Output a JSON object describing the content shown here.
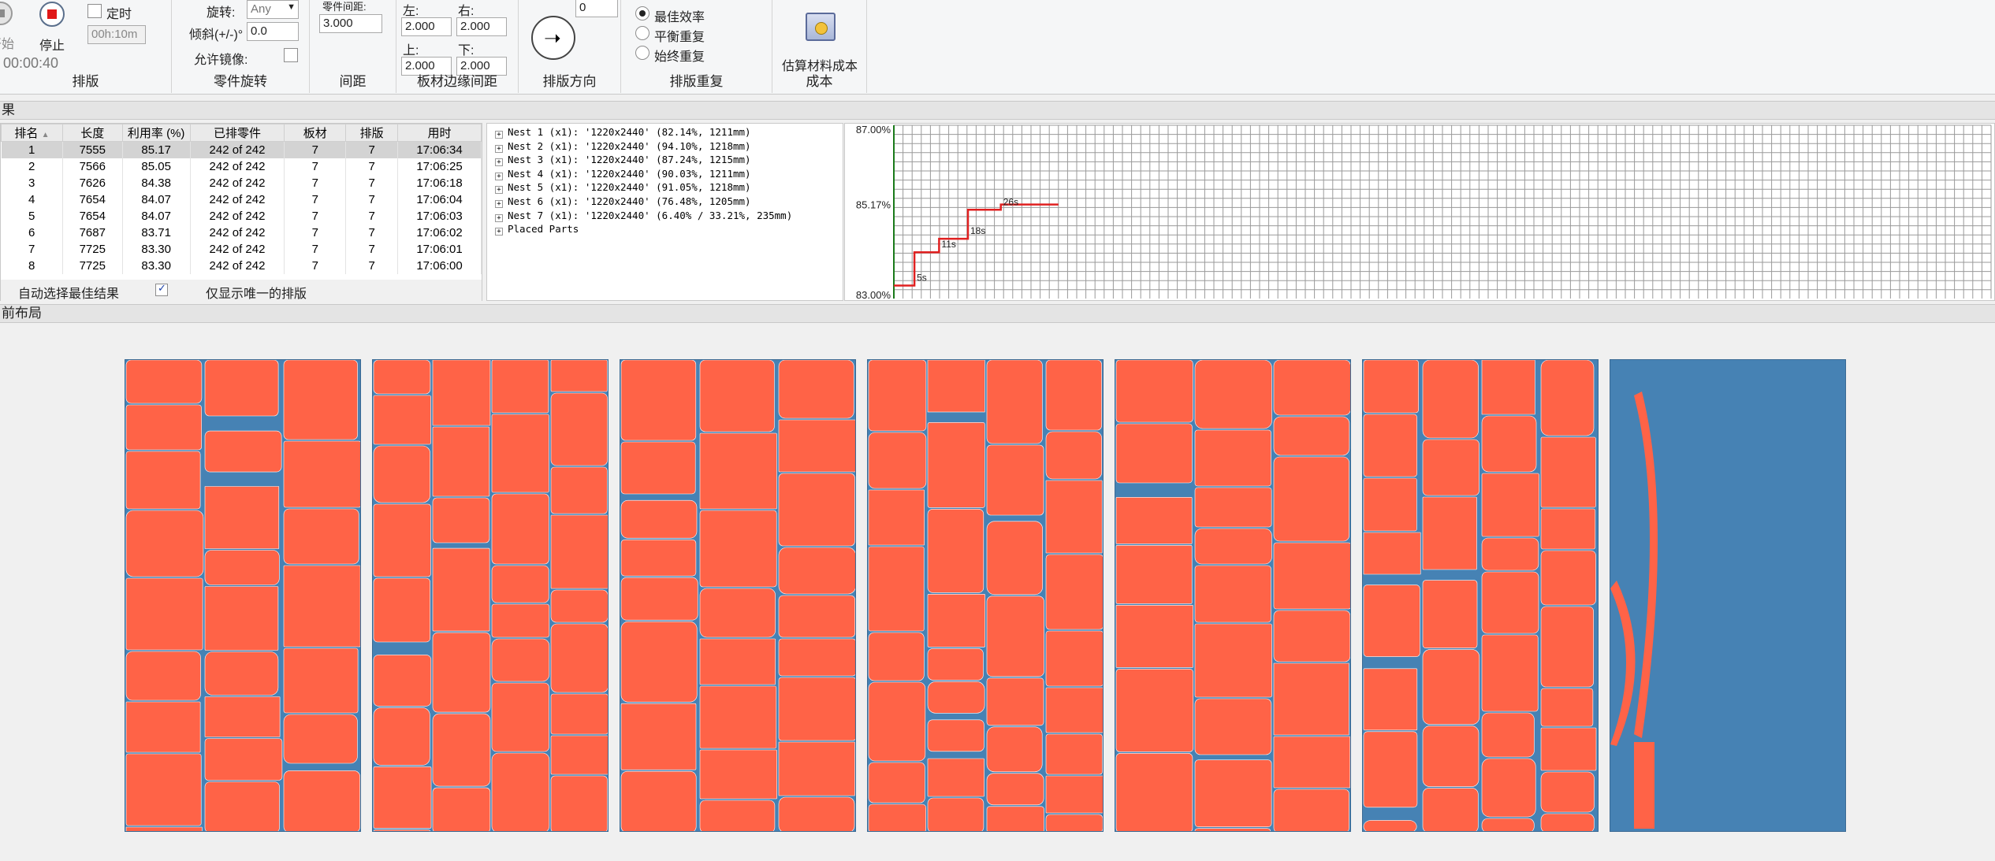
{
  "ribbon": {
    "nesting": {
      "start_label": "开始",
      "stop_label": "停止",
      "timer_label": "定时",
      "timer_value": "00h:10m",
      "elapsed": "00:00:40",
      "group_title": "排版"
    },
    "rotation": {
      "rotate_label": "旋转:",
      "rotate_value": "Any",
      "tilt_label": "倾斜(+/-)°",
      "tilt_value": "0.0",
      "mirror_label": "允许镜像:",
      "group_title": "零件旋转"
    },
    "spacing": {
      "part_gap_label": "零件间距:",
      "part_gap_value": "3.000",
      "group_title": "间距"
    },
    "margins": {
      "left_label": "左:",
      "left_value": "2.000",
      "right_label": "右:",
      "right_value": "2.000",
      "top_label": "上:",
      "top_value": "2.000",
      "bottom_label": "下:",
      "bottom_value": "2.000",
      "group_title": "板材边缘间距"
    },
    "direction": {
      "angle_value": "0",
      "group_title": "排版方向"
    },
    "repeat": {
      "options": [
        "最佳效率",
        "平衡重复",
        "始终重复"
      ],
      "selected_index": 0,
      "group_title": "排版重复"
    },
    "cost": {
      "button_label": "估算材料成本",
      "group_title": "成本"
    }
  },
  "results_section_label": "果",
  "results": {
    "columns": [
      "排名",
      "长度",
      "利用率 (%)",
      "已排零件",
      "板材",
      "排版",
      "用时"
    ],
    "rows": [
      [
        "1",
        "7555",
        "85.17",
        "242 of 242",
        "7",
        "7",
        "17:06:34"
      ],
      [
        "2",
        "7566",
        "85.05",
        "242 of 242",
        "7",
        "7",
        "17:06:25"
      ],
      [
        "3",
        "7626",
        "84.38",
        "242 of 242",
        "7",
        "7",
        "17:06:18"
      ],
      [
        "4",
        "7654",
        "84.07",
        "242 of 242",
        "7",
        "7",
        "17:06:04"
      ],
      [
        "5",
        "7654",
        "84.07",
        "242 of 242",
        "7",
        "7",
        "17:06:03"
      ],
      [
        "6",
        "7687",
        "83.71",
        "242 of 242",
        "7",
        "7",
        "17:06:02"
      ],
      [
        "7",
        "7725",
        "83.30",
        "242 of 242",
        "7",
        "7",
        "17:06:01"
      ],
      [
        "8",
        "7725",
        "83.30",
        "242 of 242",
        "7",
        "7",
        "17:06:00"
      ]
    ],
    "selected_row": 0,
    "auto_select_label": "自动选择最佳结果",
    "unique_only_label": "仅显示唯一的排版"
  },
  "tree": {
    "items": [
      "Nest 1 (x1): '1220x2440' (82.14%, 1211mm)",
      "Nest 2 (x1): '1220x2440' (94.10%, 1218mm)",
      "Nest 3 (x1): '1220x2440' (87.24%, 1215mm)",
      "Nest 4 (x1): '1220x2440' (90.03%, 1211mm)",
      "Nest 5 (x1): '1220x2440' (91.05%, 1218mm)",
      "Nest 6 (x1): '1220x2440' (76.48%, 1205mm)",
      "Nest 7 (x1): '1220x2440' (6.40% / 33.21%, 235mm)",
      "Placed Parts"
    ]
  },
  "chart_data": {
    "type": "line",
    "title": "",
    "y_tick_labels": [
      "87.00%",
      "85.17%",
      "83.00%"
    ],
    "ylim": [
      83.0,
      87.0
    ],
    "xlim": [
      0,
      40
    ],
    "x": [
      0,
      5,
      5,
      11,
      11,
      18,
      18,
      26,
      26,
      40
    ],
    "y": [
      83.3,
      83.3,
      84.07,
      84.07,
      84.38,
      84.38,
      85.05,
      85.05,
      85.17,
      85.17
    ],
    "annotations": [
      {
        "x": 5,
        "y": 83.3,
        "text": "5s"
      },
      {
        "x": 11,
        "y": 84.07,
        "text": "11s"
      },
      {
        "x": 18,
        "y": 84.38,
        "text": "18s"
      },
      {
        "x": 26,
        "y": 85.05,
        "text": "26s"
      }
    ],
    "grid": true,
    "line_color": "#e02020"
  },
  "layout_section_label": "前布局",
  "colors": {
    "sheet": "#4682b4",
    "part": "#ff6347",
    "grid": "#a9a9a9"
  },
  "sheets": [
    {
      "usage": 0.82
    },
    {
      "usage": 0.94
    },
    {
      "usage": 0.87
    },
    {
      "usage": 0.9
    },
    {
      "usage": 0.91
    },
    {
      "usage": 0.76
    },
    {
      "usage": 0.064
    }
  ]
}
